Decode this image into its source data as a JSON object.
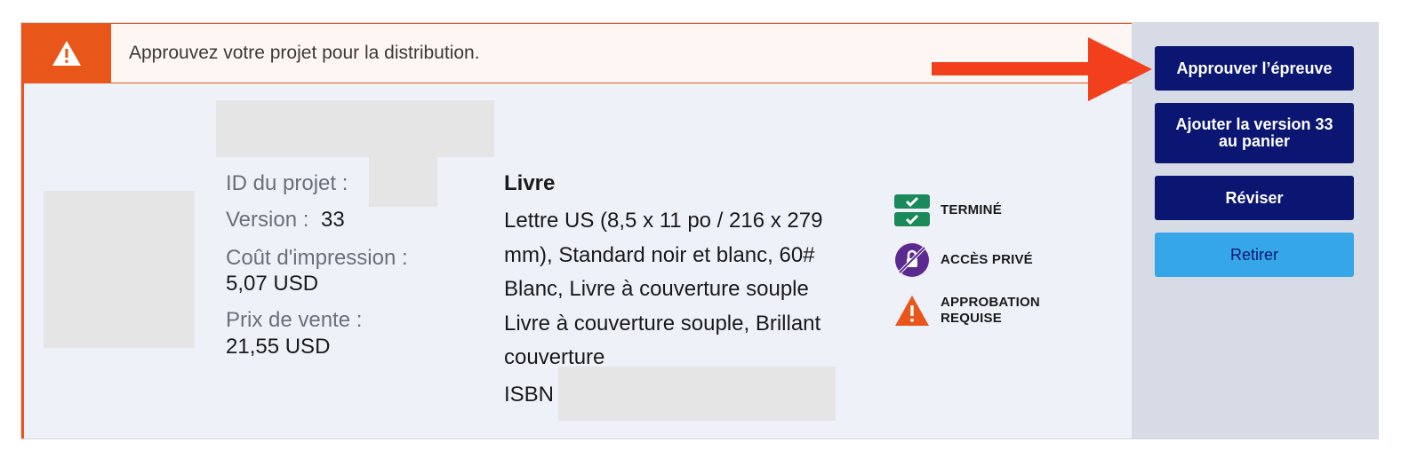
{
  "alert": {
    "message": "Approuvez votre projet pour la distribution."
  },
  "project": {
    "id_label": "ID du projet :",
    "version_label": "Version :",
    "version_value": "33",
    "print_cost_label": "Coût d'impression :",
    "print_cost_value": "5,07 USD",
    "sale_price_label": "Prix de vente :",
    "sale_price_value": "21,55 USD"
  },
  "product": {
    "title": "Livre",
    "description": "Lettre US (8,5 x 11 po / 216 x 279 mm), Standard noir et blanc, 60# Blanc, Livre à couverture souple Livre à couverture souple, Brillant couverture",
    "isbn_label": "ISBN"
  },
  "statuses": {
    "completed": "TERMINÉ",
    "private": "ACCÈS PRIVÉ",
    "approval_line1": "APPROBATION",
    "approval_line2": "REQUISE"
  },
  "buttons": {
    "approve": "Approuver l’épreuve",
    "add_line1": "Ajouter la version 33",
    "add_line2": "au panier",
    "revise": "Réviser",
    "remove": "Retirer"
  },
  "colors": {
    "accent_orange": "#e8561a",
    "primary_navy": "#0b1672",
    "secondary_blue": "#35a6e8",
    "success_green": "#1b8a5a",
    "private_purple": "#5b2a8e",
    "annotation_arrow": "#f2401c"
  }
}
